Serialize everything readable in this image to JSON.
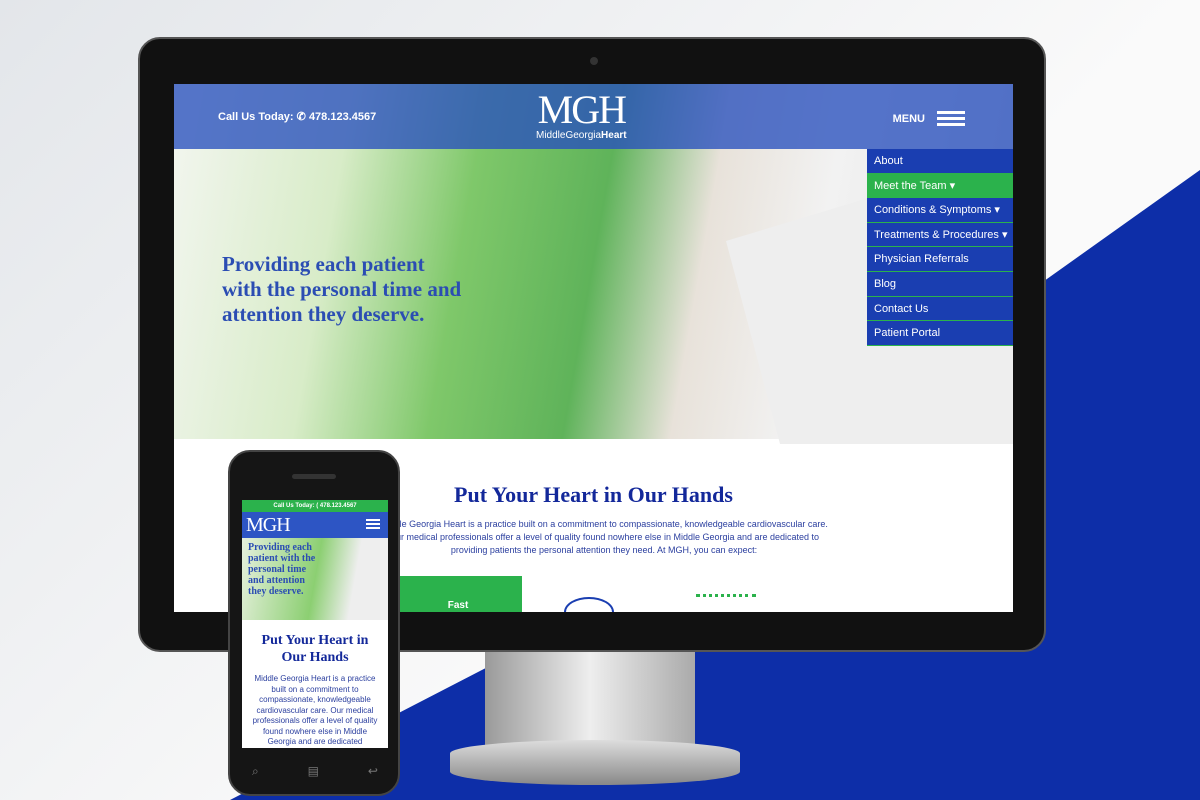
{
  "header": {
    "call_label": "Call Us Today:",
    "phone": "478.123.4567",
    "logo_mark": "MGH",
    "logo_text_light": "MiddleGeorgia",
    "logo_text_bold": "Heart",
    "menu_label": "MENU"
  },
  "hero": {
    "tagline": "Providing each patient with the personal time and attention they deserve."
  },
  "nav": {
    "items": [
      {
        "label": "About"
      },
      {
        "label": "Meet the Team ▾"
      },
      {
        "label": "Conditions & Symptoms ▾"
      },
      {
        "label": "Treatments & Procedures ▾"
      },
      {
        "label": "Physician Referrals"
      },
      {
        "label": "Blog"
      },
      {
        "label": "Contact Us"
      },
      {
        "label": "Patient Portal"
      }
    ],
    "active": "Meet the Team"
  },
  "section": {
    "title": "Put Your Heart in Our Hands",
    "body": "Middle Georgia Heart is a practice built on a commitment to compassionate, knowledgeable cardiovascular care. Our medical professionals offer a level of quality found nowhere else in Middle Georgia and are dedicated to providing patients the personal attention they need. At MGH, you can expect:",
    "card_label": "Fast"
  },
  "mobile": {
    "call_bar": "Call Us Today: ( 478.123.4567",
    "logo_mark": "MGH",
    "tagline": "Providing each patient with the personal time and attention they deserve.",
    "title": "Put Your Heart in Our Hands",
    "body": "Middle Georgia Heart is a practice built on a commitment to compassionate, knowledgeable cardiovascular care. Our medical professionals offer a level of quality found nowhere else in Middle Georgia and are dedicated"
  },
  "colors": {
    "brand_blue": "#1a3eb1",
    "brand_green": "#2bb24c",
    "text_blue": "#13289a"
  }
}
